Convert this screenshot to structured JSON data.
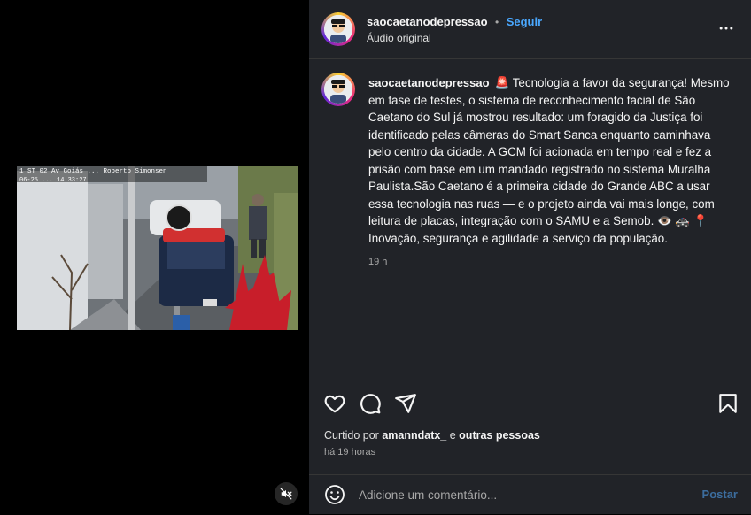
{
  "header": {
    "username": "saocaetanodepressao",
    "separator": "•",
    "follow_label": "Seguir",
    "audio": "Áudio original"
  },
  "caption": {
    "username": "saocaetanodepressao",
    "text": "🚨 Tecnologia a favor da segurança! Mesmo em fase de testes, o sistema de reconhecimento facial de São Caetano do Sul já mostrou resultado: um foragido da Justiça foi identificado pelas câmeras do Smart Sanca enquanto caminhava pelo centro da cidade. A GCM foi acionada em tempo real e fez a prisão com base em um mandado registrado no sistema Muralha Paulista.São Caetano é a primeira cidade do Grande ABC a usar essa tecnologia nas ruas — e o projeto ainda vai mais longe, com leitura de placas, integração com o SAMU e a Semob. 👁️ 🚓 📍Inovação, segurança e agilidade a serviço da população.",
    "time": "19 h"
  },
  "video": {
    "overlay_text": "1   ST 02  Av Goiás  ...  Roberto Simonsen",
    "timestamp": "06-25  ...  14:33:27"
  },
  "likes": {
    "prefix": "Curtido por ",
    "user": "amanndatx_",
    "middle": " e ",
    "others": "outras pessoas"
  },
  "posted_ago": "há 19 horas",
  "comment": {
    "placeholder": "Adicione um comentário...",
    "post_label": "Postar"
  },
  "colors": {
    "panel_bg": "#212328",
    "accent": "#4aa8ff",
    "post_disabled": "#3c6d9e"
  },
  "icons": [
    "heart-icon",
    "comment-icon",
    "share-icon",
    "bookmark-icon",
    "more-icon",
    "mute-icon",
    "emoji-icon"
  ]
}
